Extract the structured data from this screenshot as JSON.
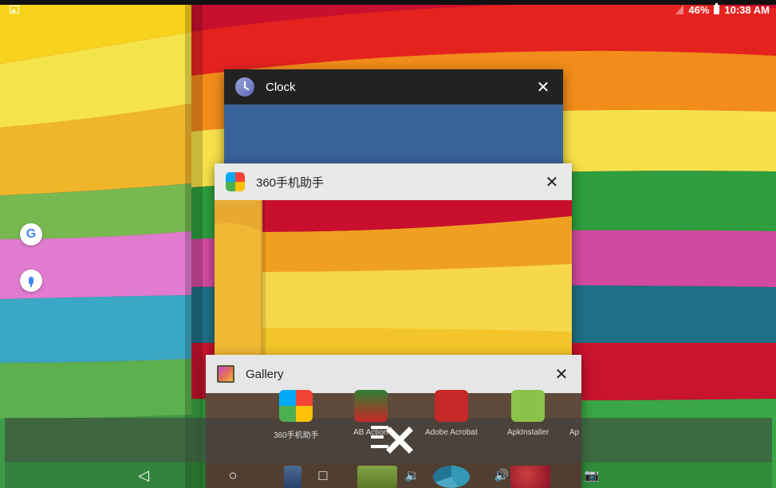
{
  "status": {
    "battery_text": "46%",
    "time": "10:38 AM"
  },
  "side_dock": {
    "google_letter": "G"
  },
  "cards": {
    "clock": {
      "title": "Clock",
      "close": "✕",
      "color": "#3a6399"
    },
    "app360": {
      "title": "360手机助手",
      "close": "✕"
    },
    "gallery": {
      "title": "Gallery",
      "close": "✕"
    }
  },
  "strip_apps": [
    {
      "label": "360手机助手"
    },
    {
      "label": "AB Action"
    },
    {
      "label": "Adobe Acrobat"
    },
    {
      "label": "ApkInstaller"
    },
    {
      "label": "Ap"
    }
  ],
  "nav": {
    "back": "◁",
    "home": "○",
    "recents": "□",
    "vol_down": "🔉",
    "vol_up": "🔊",
    "camera": "📷"
  },
  "colors": {
    "header_dark": "#222222",
    "header_light": "#e9e9e9",
    "clock_body": "#3a6399"
  }
}
